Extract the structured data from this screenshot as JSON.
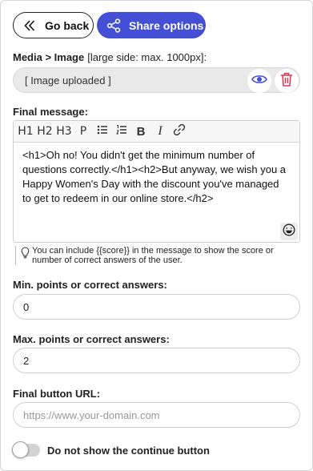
{
  "header": {
    "back_label": "Go back",
    "share_label": "Share options"
  },
  "media": {
    "label": "Media > Image",
    "hint": "[large side: max. 1000px]:",
    "value": "[ Image uploaded ]"
  },
  "final_message": {
    "label": "Final message:",
    "toolbar": [
      "H1",
      "H2",
      "H3",
      "P",
      "B",
      "I"
    ],
    "content": "<h1>Oh no! You didn't get the minimum number of questions correctly.</h1><h2>But anyway, we wish you a Happy Women's Day with the discount you've managed to get to redeem in our online store.</h2>",
    "info": "You can include {{score}} in the message to show the score or number of correct answers of the user."
  },
  "min_points": {
    "label": "Min. points or correct answers:",
    "value": "0"
  },
  "max_points": {
    "label": "Max. points or correct answers:",
    "value": "2"
  },
  "final_url": {
    "label": "Final button URL:",
    "placeholder": "https://www.your-domain.com"
  },
  "continue_toggle": {
    "label": "Do not show the continue button",
    "on": false
  },
  "colors": {
    "accent": "#4350d5",
    "delete": "#d9364f"
  }
}
